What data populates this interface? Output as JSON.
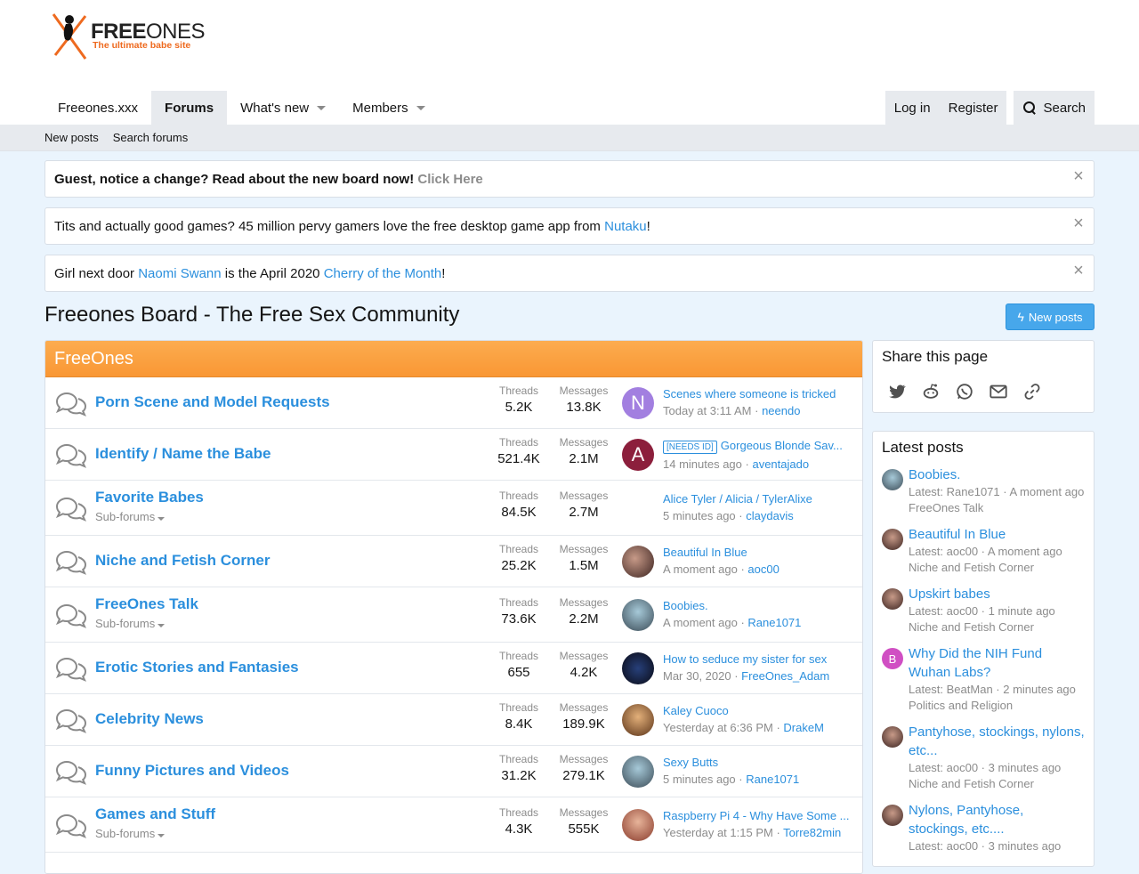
{
  "logo": {
    "word_bold": "FREE",
    "word_light": "ONES",
    "tagline": "The ultimate babe site"
  },
  "nav": {
    "items": [
      {
        "label": "Freeones.xxx"
      },
      {
        "label": "Forums"
      },
      {
        "label": "What's new"
      },
      {
        "label": "Members"
      }
    ],
    "login": "Log in",
    "register": "Register",
    "search": "Search"
  },
  "subnav": {
    "new_posts": "New posts",
    "search_forums": "Search forums"
  },
  "notices": {
    "n1": {
      "bold": "Guest, notice a change? Read about the new board now!",
      "link": "Click Here"
    },
    "n2": {
      "before": "Tits and actually good games? 45 million pervy gamers love the free desktop game app from ",
      "link": "Nutaku",
      "after": "!"
    },
    "n3": {
      "before": "Girl next door ",
      "link1": "Naomi Swann",
      "middle": " is the April 2020 ",
      "link2": "Cherry of the Month",
      "after": "!"
    },
    "close": "×"
  },
  "page": {
    "title": "Freeones Board - The Free Sex Community",
    "new_posts_btn": "New posts"
  },
  "category": {
    "title": "FreeOnes"
  },
  "labels": {
    "threads": "Threads",
    "messages": "Messages",
    "subforums": "Sub-forums"
  },
  "forums": [
    {
      "title": "Porn Scene and Model Requests",
      "threads": "5.2K",
      "messages": "13.8K",
      "avatar": "N",
      "last_title": "Scenes where someone is tricked",
      "last_time": "Today at 3:11 AM",
      "last_user": "neendo"
    },
    {
      "title": "Identify / Name the Babe",
      "threads": "521.4K",
      "messages": "2.1M",
      "avatar": "A",
      "last_tag": "[NEEDS ID]",
      "last_title": "Gorgeous Blonde Sav...",
      "last_time": "14 minutes ago",
      "last_user": "aventajado"
    },
    {
      "title": "Favorite Babes",
      "threads": "84.5K",
      "messages": "2.7M",
      "last_title": "Alice Tyler / Alicia / TylerAlixe",
      "last_time": "5 minutes ago",
      "last_user": "claydavis"
    },
    {
      "title": "Niche and Fetish Corner",
      "threads": "25.2K",
      "messages": "1.5M",
      "last_title": "Beautiful In Blue",
      "last_time": "A moment ago",
      "last_user": "aoc00"
    },
    {
      "title": "FreeOnes Talk",
      "threads": "73.6K",
      "messages": "2.2M",
      "last_title": "Boobies.",
      "last_time": "A moment ago",
      "last_user": "Rane1071"
    },
    {
      "title": "Erotic Stories and Fantasies",
      "threads": "655",
      "messages": "4.2K",
      "last_title": "How to seduce my sister for sex",
      "last_time": "Mar 30, 2020",
      "last_user": "FreeOnes_Adam"
    },
    {
      "title": "Celebrity News",
      "threads": "8.4K",
      "messages": "189.9K",
      "last_title": "Kaley Cuoco",
      "last_time": "Yesterday at 6:36 PM",
      "last_user": "DrakeM"
    },
    {
      "title": "Funny Pictures and Videos",
      "threads": "31.2K",
      "messages": "279.1K",
      "last_title": "Sexy Butts",
      "last_time": "5 minutes ago",
      "last_user": "Rane1071"
    },
    {
      "title": "Games and Stuff",
      "threads": "4.3K",
      "messages": "555K",
      "last_title": "Raspberry Pi 4 - Why Have Some ...",
      "last_time": "Yesterday at 1:15 PM",
      "last_user": "Torre82min"
    }
  ],
  "share": {
    "title": "Share this page"
  },
  "latest": {
    "title": "Latest posts",
    "items": [
      {
        "title": "Boobies.",
        "meta": "Latest: Rane1071 · A moment ago",
        "forum": "FreeOnes Talk"
      },
      {
        "title": "Beautiful In Blue",
        "meta": "Latest: aoc00 · A moment ago",
        "forum": "Niche and Fetish Corner"
      },
      {
        "title": "Upskirt babes",
        "meta": "Latest: aoc00 · 1 minute ago",
        "forum": "Niche and Fetish Corner"
      },
      {
        "title": "Why Did the NIH Fund Wuhan Labs?",
        "avatar": "B",
        "meta": "Latest: BeatMan · 2 minutes ago",
        "forum": "Politics and Religion"
      },
      {
        "title": "Pantyhose, stockings, nylons, etc...",
        "meta": "Latest: aoc00 · 3 minutes ago",
        "forum": "Niche and Fetish Corner"
      },
      {
        "title": "Nylons, Pantyhose, stockings, etc....",
        "meta": "Latest: aoc00 · 3 minutes ago",
        "forum": ""
      }
    ]
  }
}
